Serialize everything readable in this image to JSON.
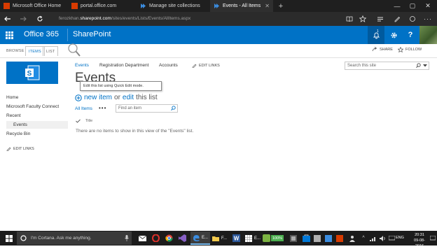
{
  "browser": {
    "tabs": [
      {
        "title": "Microsoft Office Home"
      },
      {
        "title": "portal.office.com"
      },
      {
        "title": "Manage site collections"
      },
      {
        "title": "Events - All Items"
      }
    ],
    "url_prefix": "ferozkhan.",
    "url_host": "sharepoint.com",
    "url_path": "/sites/events/Lists/Events/AllItems.aspx"
  },
  "suite": {
    "app_name": "Office 365",
    "product_name": "SharePoint",
    "notification_count": "1"
  },
  "ribbon": {
    "tabs": [
      "BROWSE",
      "ITEMS",
      "LIST"
    ],
    "share_label": "SHARE",
    "follow_label": "FOLLOW"
  },
  "left_nav": {
    "items": [
      {
        "label": "Home"
      },
      {
        "label": "Microsoft Faculty Connect"
      },
      {
        "label": "Recent"
      },
      {
        "label": "Events"
      },
      {
        "label": "Recycle Bin"
      }
    ],
    "edit_links": "EDIT LINKS"
  },
  "top_nav": {
    "items": [
      "Events",
      "Registration Department",
      "Accounts"
    ],
    "edit_links": "EDIT LINKS"
  },
  "search": {
    "placeholder": "Search this site"
  },
  "main": {
    "title": "Events",
    "tooltip": "Edit this list using Quick Edit mode.",
    "new_item": "new item",
    "or_text": "or",
    "edit_text": "edit",
    "this_list": "this list",
    "view_name": "All Items",
    "ellipsis": "•••",
    "find_placeholder": "Find an item",
    "column_title": "Title",
    "empty_message": "There are no items to show in this view of the \"Events\" list."
  },
  "taskbar": {
    "cortana_text": "I'm Cortana. Ask me anything.",
    "apps": [
      "E...",
      "F...",
      "E..."
    ],
    "battery": "100%",
    "language": "ENG",
    "time": "20:31",
    "date": "09-08-2016"
  },
  "colors": {
    "accent": "#0072c6",
    "suite_bar": "#0072c6",
    "chrome_dark": "#1f1f1f"
  }
}
